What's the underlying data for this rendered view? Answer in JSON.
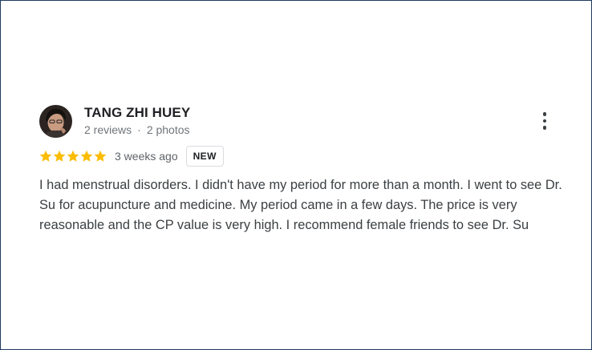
{
  "review": {
    "author_name": "TANG ZHI HUEY",
    "reviews_count": "2 reviews",
    "meta_separator": "·",
    "photos_count": "2 photos",
    "rating": 5,
    "rating_max": 5,
    "time_ago": "3 weeks ago",
    "badge": "NEW",
    "text": "I had menstrual disorders. I didn't have my period for more than a month. I went to see Dr. Su for acupuncture and medicine. My period came in a few days. The price is very reasonable and the CP value is very high. I recommend female friends to see Dr. Su",
    "more_icon": "more-vert-icon",
    "star_color": "#fbbc04"
  }
}
